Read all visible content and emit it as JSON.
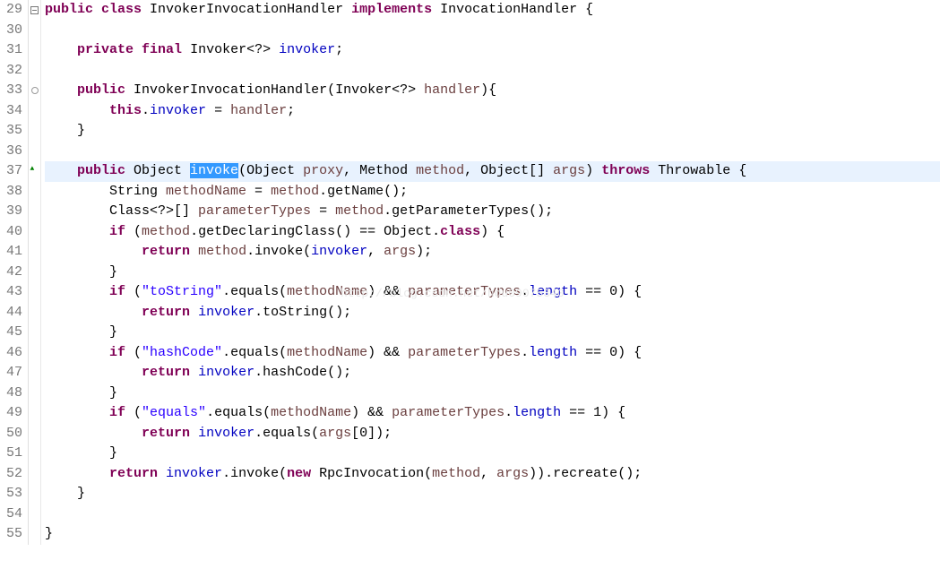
{
  "watermark": "http://blog.csdn.net/hdu09075340",
  "lines": [
    {
      "num": 29,
      "marker": "minus",
      "tokens": [
        {
          "t": "kw",
          "v": "public"
        },
        {
          "t": "p",
          "v": " "
        },
        {
          "t": "kw",
          "v": "class"
        },
        {
          "t": "p",
          "v": " InvokerInvocationHandler "
        },
        {
          "t": "kw",
          "v": "implements"
        },
        {
          "t": "p",
          "v": " InvocationHandler {"
        }
      ]
    },
    {
      "num": 30,
      "marker": "",
      "tokens": []
    },
    {
      "num": 31,
      "marker": "",
      "tokens": [
        {
          "t": "p",
          "v": "    "
        },
        {
          "t": "kw",
          "v": "private"
        },
        {
          "t": "p",
          "v": " "
        },
        {
          "t": "kw",
          "v": "final"
        },
        {
          "t": "p",
          "v": " Invoker<?> "
        },
        {
          "t": "field",
          "v": "invoker"
        },
        {
          "t": "p",
          "v": ";"
        }
      ]
    },
    {
      "num": 32,
      "marker": "",
      "tokens": []
    },
    {
      "num": 33,
      "marker": "circle-minus",
      "tokens": [
        {
          "t": "p",
          "v": "    "
        },
        {
          "t": "kw",
          "v": "public"
        },
        {
          "t": "p",
          "v": " InvokerInvocationHandler(Invoker<?> "
        },
        {
          "t": "var",
          "v": "handler"
        },
        {
          "t": "p",
          "v": "){"
        }
      ]
    },
    {
      "num": 34,
      "marker": "",
      "tokens": [
        {
          "t": "p",
          "v": "        "
        },
        {
          "t": "kw",
          "v": "this"
        },
        {
          "t": "p",
          "v": "."
        },
        {
          "t": "field",
          "v": "invoker"
        },
        {
          "t": "p",
          "v": " = "
        },
        {
          "t": "var",
          "v": "handler"
        },
        {
          "t": "p",
          "v": ";"
        }
      ]
    },
    {
      "num": 35,
      "marker": "",
      "tokens": [
        {
          "t": "p",
          "v": "    }"
        }
      ]
    },
    {
      "num": 36,
      "marker": "",
      "tokens": []
    },
    {
      "num": 37,
      "marker": "override-minus",
      "highlighted": true,
      "tokens": [
        {
          "t": "p",
          "v": "    "
        },
        {
          "t": "kw",
          "v": "public"
        },
        {
          "t": "p",
          "v": " Object "
        },
        {
          "t": "sel",
          "v": "invoke"
        },
        {
          "t": "p",
          "v": "(Object "
        },
        {
          "t": "var",
          "v": "proxy"
        },
        {
          "t": "p",
          "v": ", Method "
        },
        {
          "t": "var",
          "v": "method"
        },
        {
          "t": "p",
          "v": ", Object[] "
        },
        {
          "t": "var",
          "v": "args"
        },
        {
          "t": "p",
          "v": ") "
        },
        {
          "t": "kw",
          "v": "throws"
        },
        {
          "t": "p",
          "v": " Throwable {"
        }
      ]
    },
    {
      "num": 38,
      "marker": "",
      "tokens": [
        {
          "t": "p",
          "v": "        String "
        },
        {
          "t": "var",
          "v": "methodName"
        },
        {
          "t": "p",
          "v": " = "
        },
        {
          "t": "var",
          "v": "method"
        },
        {
          "t": "p",
          "v": ".getName();"
        }
      ]
    },
    {
      "num": 39,
      "marker": "",
      "tokens": [
        {
          "t": "p",
          "v": "        Class<?>[] "
        },
        {
          "t": "var",
          "v": "parameterTypes"
        },
        {
          "t": "p",
          "v": " = "
        },
        {
          "t": "var",
          "v": "method"
        },
        {
          "t": "p",
          "v": ".getParameterTypes();"
        }
      ]
    },
    {
      "num": 40,
      "marker": "",
      "tokens": [
        {
          "t": "p",
          "v": "        "
        },
        {
          "t": "kw",
          "v": "if"
        },
        {
          "t": "p",
          "v": " ("
        },
        {
          "t": "var",
          "v": "method"
        },
        {
          "t": "p",
          "v": ".getDeclaringClass() == Object."
        },
        {
          "t": "kw",
          "v": "class"
        },
        {
          "t": "p",
          "v": ") {"
        }
      ]
    },
    {
      "num": 41,
      "marker": "",
      "tokens": [
        {
          "t": "p",
          "v": "            "
        },
        {
          "t": "kw",
          "v": "return"
        },
        {
          "t": "p",
          "v": " "
        },
        {
          "t": "var",
          "v": "method"
        },
        {
          "t": "p",
          "v": ".invoke("
        },
        {
          "t": "field",
          "v": "invoker"
        },
        {
          "t": "p",
          "v": ", "
        },
        {
          "t": "var",
          "v": "args"
        },
        {
          "t": "p",
          "v": ");"
        }
      ]
    },
    {
      "num": 42,
      "marker": "",
      "tokens": [
        {
          "t": "p",
          "v": "        }"
        }
      ]
    },
    {
      "num": 43,
      "marker": "",
      "tokens": [
        {
          "t": "p",
          "v": "        "
        },
        {
          "t": "kw",
          "v": "if"
        },
        {
          "t": "p",
          "v": " ("
        },
        {
          "t": "str",
          "v": "\"toString\""
        },
        {
          "t": "p",
          "v": ".equals("
        },
        {
          "t": "var",
          "v": "methodName"
        },
        {
          "t": "p",
          "v": ") && "
        },
        {
          "t": "var",
          "v": "parameterTypes"
        },
        {
          "t": "p",
          "v": "."
        },
        {
          "t": "field",
          "v": "length"
        },
        {
          "t": "p",
          "v": " == 0) {"
        }
      ]
    },
    {
      "num": 44,
      "marker": "",
      "tokens": [
        {
          "t": "p",
          "v": "            "
        },
        {
          "t": "kw",
          "v": "return"
        },
        {
          "t": "p",
          "v": " "
        },
        {
          "t": "field",
          "v": "invoker"
        },
        {
          "t": "p",
          "v": ".toString();"
        }
      ]
    },
    {
      "num": 45,
      "marker": "",
      "tokens": [
        {
          "t": "p",
          "v": "        }"
        }
      ]
    },
    {
      "num": 46,
      "marker": "",
      "tokens": [
        {
          "t": "p",
          "v": "        "
        },
        {
          "t": "kw",
          "v": "if"
        },
        {
          "t": "p",
          "v": " ("
        },
        {
          "t": "str",
          "v": "\"hashCode\""
        },
        {
          "t": "p",
          "v": ".equals("
        },
        {
          "t": "var",
          "v": "methodName"
        },
        {
          "t": "p",
          "v": ") && "
        },
        {
          "t": "var",
          "v": "parameterTypes"
        },
        {
          "t": "p",
          "v": "."
        },
        {
          "t": "field",
          "v": "length"
        },
        {
          "t": "p",
          "v": " == 0) {"
        }
      ]
    },
    {
      "num": 47,
      "marker": "",
      "tokens": [
        {
          "t": "p",
          "v": "            "
        },
        {
          "t": "kw",
          "v": "return"
        },
        {
          "t": "p",
          "v": " "
        },
        {
          "t": "field",
          "v": "invoker"
        },
        {
          "t": "p",
          "v": ".hashCode();"
        }
      ]
    },
    {
      "num": 48,
      "marker": "",
      "tokens": [
        {
          "t": "p",
          "v": "        }"
        }
      ]
    },
    {
      "num": 49,
      "marker": "",
      "tokens": [
        {
          "t": "p",
          "v": "        "
        },
        {
          "t": "kw",
          "v": "if"
        },
        {
          "t": "p",
          "v": " ("
        },
        {
          "t": "str",
          "v": "\"equals\""
        },
        {
          "t": "p",
          "v": ".equals("
        },
        {
          "t": "var",
          "v": "methodName"
        },
        {
          "t": "p",
          "v": ") && "
        },
        {
          "t": "var",
          "v": "parameterTypes"
        },
        {
          "t": "p",
          "v": "."
        },
        {
          "t": "field",
          "v": "length"
        },
        {
          "t": "p",
          "v": " == 1) {"
        }
      ]
    },
    {
      "num": 50,
      "marker": "",
      "tokens": [
        {
          "t": "p",
          "v": "            "
        },
        {
          "t": "kw",
          "v": "return"
        },
        {
          "t": "p",
          "v": " "
        },
        {
          "t": "field",
          "v": "invoker"
        },
        {
          "t": "p",
          "v": ".equals("
        },
        {
          "t": "var",
          "v": "args"
        },
        {
          "t": "p",
          "v": "[0]);"
        }
      ]
    },
    {
      "num": 51,
      "marker": "",
      "tokens": [
        {
          "t": "p",
          "v": "        }"
        }
      ]
    },
    {
      "num": 52,
      "marker": "",
      "tokens": [
        {
          "t": "p",
          "v": "        "
        },
        {
          "t": "kw",
          "v": "return"
        },
        {
          "t": "p",
          "v": " "
        },
        {
          "t": "field",
          "v": "invoker"
        },
        {
          "t": "p",
          "v": ".invoke("
        },
        {
          "t": "kw",
          "v": "new"
        },
        {
          "t": "p",
          "v": " RpcInvocation("
        },
        {
          "t": "var",
          "v": "method"
        },
        {
          "t": "p",
          "v": ", "
        },
        {
          "t": "var",
          "v": "args"
        },
        {
          "t": "p",
          "v": ")).recreate();"
        }
      ]
    },
    {
      "num": 53,
      "marker": "",
      "tokens": [
        {
          "t": "p",
          "v": "    }"
        }
      ]
    },
    {
      "num": 54,
      "marker": "",
      "tokens": []
    },
    {
      "num": 55,
      "marker": "",
      "tokens": [
        {
          "t": "p",
          "v": "}"
        }
      ]
    }
  ]
}
